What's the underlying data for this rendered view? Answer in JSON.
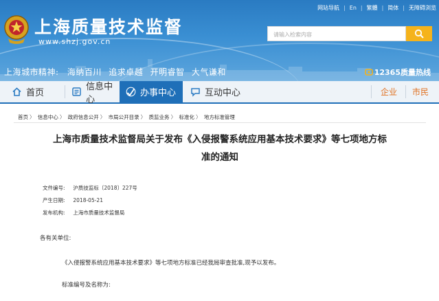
{
  "header": {
    "site_title": "上海质量技术监督",
    "site_url": "www.shzj.gov.cn",
    "toplinks": [
      "网站导航",
      "En",
      "繁體",
      "简体",
      "无障碍浏览"
    ],
    "search_placeholder": "请输入检索内容",
    "spirit_label": "上海城市精神:",
    "spirit_items": [
      "海纳百川",
      "追求卓越",
      "开明睿智",
      "大气谦和"
    ],
    "hotline": "12365质量热线"
  },
  "nav": {
    "items": [
      {
        "label": "首页",
        "icon": "home-icon"
      },
      {
        "label": "信息中心",
        "icon": "info-icon"
      },
      {
        "label": "办事中心",
        "icon": "service-icon"
      },
      {
        "label": "互动中心",
        "icon": "chat-icon"
      }
    ],
    "right_items": [
      "企业",
      "市民"
    ],
    "active_color": "#1f6fb8",
    "accent_color": "#e07020"
  },
  "breadcrumb": [
    "首页",
    "信息中心",
    "政府信息公开",
    "市局公开目录",
    "质监业务",
    "标准化",
    "地方标准管理"
  ],
  "article": {
    "title_line1": "上海市质量技术监督局关于发布《入侵报警系统应用基本技术要求》等七项地方标",
    "title_line2": "准的通知",
    "meta": [
      {
        "label": "文件编号:",
        "value": "沪质技监标〔2018〕227号"
      },
      {
        "label": "产生日期:",
        "value": "2018-05-21"
      },
      {
        "label": "发布机构:",
        "value": "上海市质量技术监督局"
      }
    ],
    "salutation": "各有关单位:",
    "paragraph1": "《入侵报警系统应用基本技术要求》等七项地方标准已经我局审查批准,现予以发布。",
    "paragraph2": "标准编号及名称为:"
  }
}
